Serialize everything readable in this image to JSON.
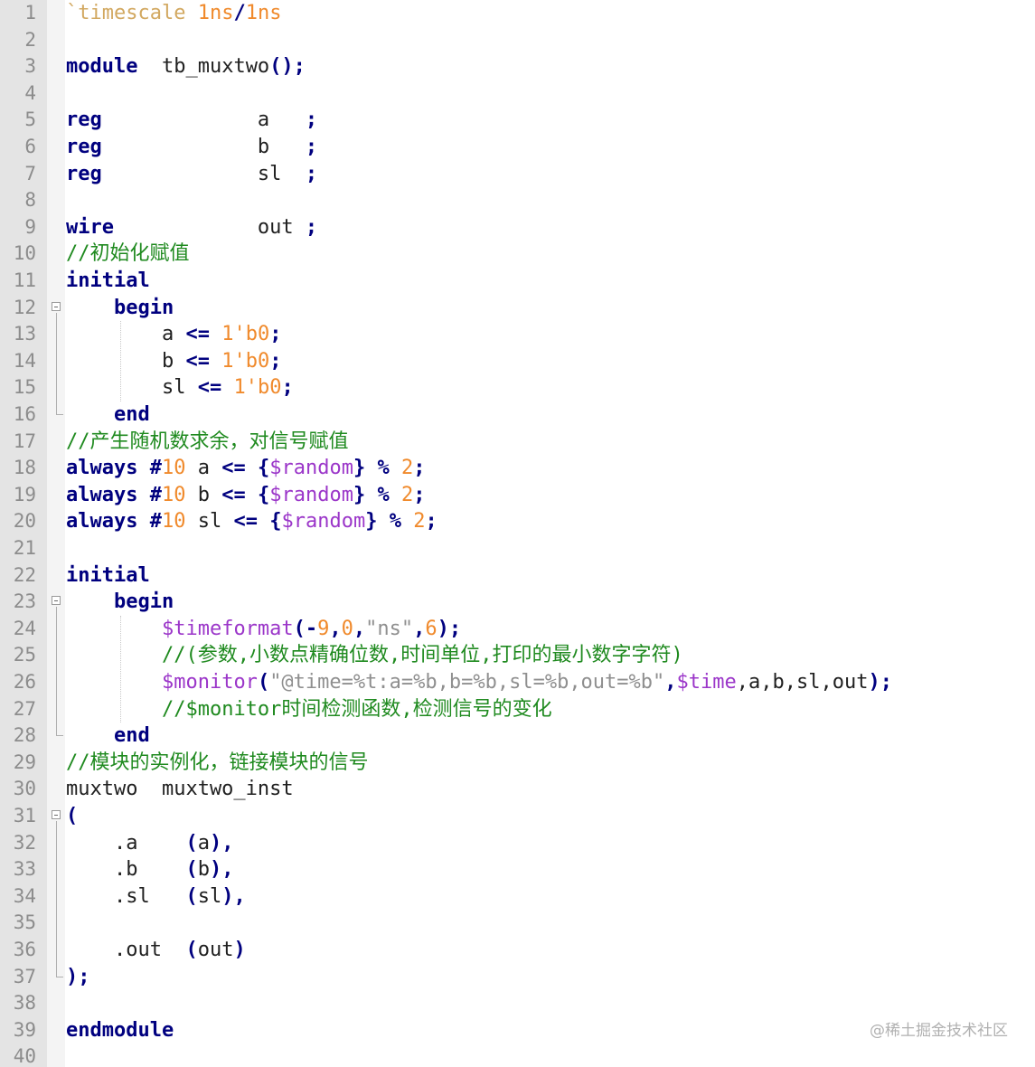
{
  "editor": {
    "lines": [
      {
        "n": "1",
        "tokens": [
          [
            "`timescale",
            "ws"
          ],
          [
            " ",
            "id"
          ],
          [
            "1ns",
            "num"
          ],
          [
            "/",
            "op"
          ],
          [
            "1ns",
            "num"
          ]
        ]
      },
      {
        "n": "2",
        "tokens": []
      },
      {
        "n": "3",
        "tokens": [
          [
            "module",
            "kw"
          ],
          [
            "  tb_muxtwo",
            "id"
          ],
          [
            "();",
            "op"
          ]
        ]
      },
      {
        "n": "4",
        "tokens": []
      },
      {
        "n": "5",
        "tokens": [
          [
            "reg",
            "kw"
          ],
          [
            "             a   ",
            "id"
          ],
          [
            ";",
            "op"
          ]
        ]
      },
      {
        "n": "6",
        "tokens": [
          [
            "reg",
            "kw"
          ],
          [
            "             b   ",
            "id"
          ],
          [
            ";",
            "op"
          ]
        ]
      },
      {
        "n": "7",
        "tokens": [
          [
            "reg",
            "kw"
          ],
          [
            "             sl  ",
            "id"
          ],
          [
            ";",
            "op"
          ]
        ]
      },
      {
        "n": "8",
        "tokens": []
      },
      {
        "n": "9",
        "tokens": [
          [
            "wire",
            "kw"
          ],
          [
            "            out ",
            "id"
          ],
          [
            ";",
            "op"
          ]
        ]
      },
      {
        "n": "10",
        "tokens": [
          [
            "//初始化赋值",
            "cm"
          ]
        ]
      },
      {
        "n": "11",
        "tokens": [
          [
            "initial",
            "kw"
          ]
        ]
      },
      {
        "n": "12",
        "tokens": [
          [
            "    ",
            "id"
          ],
          [
            "begin",
            "kw"
          ]
        ]
      },
      {
        "n": "13",
        "tokens": [
          [
            "        a ",
            "id"
          ],
          [
            "<=",
            "op"
          ],
          [
            " ",
            "id"
          ],
          [
            "1'b0",
            "num"
          ],
          [
            ";",
            "op"
          ]
        ]
      },
      {
        "n": "14",
        "tokens": [
          [
            "        b ",
            "id"
          ],
          [
            "<=",
            "op"
          ],
          [
            " ",
            "id"
          ],
          [
            "1'b0",
            "num"
          ],
          [
            ";",
            "op"
          ]
        ]
      },
      {
        "n": "15",
        "tokens": [
          [
            "        sl ",
            "id"
          ],
          [
            "<=",
            "op"
          ],
          [
            " ",
            "id"
          ],
          [
            "1'b0",
            "num"
          ],
          [
            ";",
            "op"
          ]
        ]
      },
      {
        "n": "16",
        "tokens": [
          [
            "    ",
            "id"
          ],
          [
            "end",
            "kw"
          ]
        ]
      },
      {
        "n": "17",
        "tokens": [
          [
            "//产生随机数求余，对信号赋值",
            "cm"
          ]
        ]
      },
      {
        "n": "18",
        "tokens": [
          [
            "always",
            "kw"
          ],
          [
            " ",
            "id"
          ],
          [
            "#",
            "op"
          ],
          [
            "10",
            "num"
          ],
          [
            " a ",
            "id"
          ],
          [
            "<=",
            "op"
          ],
          [
            " ",
            "id"
          ],
          [
            "{",
            "op"
          ],
          [
            "$random",
            "sys"
          ],
          [
            "}",
            "op"
          ],
          [
            " ",
            "id"
          ],
          [
            "%",
            "op"
          ],
          [
            " ",
            "id"
          ],
          [
            "2",
            "num"
          ],
          [
            ";",
            "op"
          ]
        ]
      },
      {
        "n": "19",
        "tokens": [
          [
            "always",
            "kw"
          ],
          [
            " ",
            "id"
          ],
          [
            "#",
            "op"
          ],
          [
            "10",
            "num"
          ],
          [
            " b ",
            "id"
          ],
          [
            "<=",
            "op"
          ],
          [
            " ",
            "id"
          ],
          [
            "{",
            "op"
          ],
          [
            "$random",
            "sys"
          ],
          [
            "}",
            "op"
          ],
          [
            " ",
            "id"
          ],
          [
            "%",
            "op"
          ],
          [
            " ",
            "id"
          ],
          [
            "2",
            "num"
          ],
          [
            ";",
            "op"
          ]
        ]
      },
      {
        "n": "20",
        "tokens": [
          [
            "always",
            "kw"
          ],
          [
            " ",
            "id"
          ],
          [
            "#",
            "op"
          ],
          [
            "10",
            "num"
          ],
          [
            " sl ",
            "id"
          ],
          [
            "<=",
            "op"
          ],
          [
            " ",
            "id"
          ],
          [
            "{",
            "op"
          ],
          [
            "$random",
            "sys"
          ],
          [
            "}",
            "op"
          ],
          [
            " ",
            "id"
          ],
          [
            "%",
            "op"
          ],
          [
            " ",
            "id"
          ],
          [
            "2",
            "num"
          ],
          [
            ";",
            "op"
          ]
        ]
      },
      {
        "n": "21",
        "tokens": []
      },
      {
        "n": "22",
        "tokens": [
          [
            "initial",
            "kw"
          ]
        ]
      },
      {
        "n": "23",
        "tokens": [
          [
            "    ",
            "id"
          ],
          [
            "begin",
            "kw"
          ]
        ]
      },
      {
        "n": "24",
        "tokens": [
          [
            "        ",
            "id"
          ],
          [
            "$timeformat",
            "sys"
          ],
          [
            "(",
            "op"
          ],
          [
            "-",
            "op"
          ],
          [
            "9",
            "num"
          ],
          [
            ",",
            "op"
          ],
          [
            "0",
            "num"
          ],
          [
            ",",
            "op"
          ],
          [
            "\"ns\"",
            "str"
          ],
          [
            ",",
            "op"
          ],
          [
            "6",
            "num"
          ],
          [
            ");",
            "op"
          ]
        ]
      },
      {
        "n": "25",
        "tokens": [
          [
            "        ",
            "id"
          ],
          [
            "//(参数,小数点精确位数,时间单位,打印的最小数字字符)",
            "cm"
          ]
        ]
      },
      {
        "n": "26",
        "tokens": [
          [
            "        ",
            "id"
          ],
          [
            "$monitor",
            "sys"
          ],
          [
            "(",
            "op"
          ],
          [
            "\"@time=%t:a=%b,b=%b,sl=%b,out=%b\"",
            "str"
          ],
          [
            ",",
            "op"
          ],
          [
            "$time",
            "sys"
          ],
          [
            ",a,b,sl,out",
            "id"
          ],
          [
            ");",
            "op"
          ]
        ]
      },
      {
        "n": "27",
        "tokens": [
          [
            "        ",
            "id"
          ],
          [
            "//$monitor时间检测函数,检测信号的变化",
            "cm"
          ]
        ]
      },
      {
        "n": "28",
        "tokens": [
          [
            "    ",
            "id"
          ],
          [
            "end",
            "kw"
          ]
        ]
      },
      {
        "n": "29",
        "tokens": [
          [
            "//模块的实例化，链接模块的信号",
            "cm"
          ]
        ]
      },
      {
        "n": "30",
        "tokens": [
          [
            "muxtwo  muxtwo_inst",
            "id"
          ]
        ]
      },
      {
        "n": "31",
        "tokens": [
          [
            "(",
            "op"
          ]
        ]
      },
      {
        "n": "32",
        "tokens": [
          [
            "    .a    ",
            "id"
          ],
          [
            "(",
            "op"
          ],
          [
            "a",
            "id"
          ],
          [
            "),",
            "op"
          ]
        ]
      },
      {
        "n": "33",
        "tokens": [
          [
            "    .b    ",
            "id"
          ],
          [
            "(",
            "op"
          ],
          [
            "b",
            "id"
          ],
          [
            "),",
            "op"
          ]
        ]
      },
      {
        "n": "34",
        "tokens": [
          [
            "    .sl   ",
            "id"
          ],
          [
            "(",
            "op"
          ],
          [
            "sl",
            "id"
          ],
          [
            "),",
            "op"
          ]
        ]
      },
      {
        "n": "35",
        "tokens": []
      },
      {
        "n": "36",
        "tokens": [
          [
            "    .out  ",
            "id"
          ],
          [
            "(",
            "op"
          ],
          [
            "out",
            "id"
          ],
          [
            ")",
            "op"
          ]
        ]
      },
      {
        "n": "37",
        "tokens": [
          [
            ");",
            "op"
          ]
        ]
      },
      {
        "n": "38",
        "tokens": []
      },
      {
        "n": "39",
        "tokens": [
          [
            "endmodule",
            "kw"
          ]
        ]
      },
      {
        "n": "40",
        "tokens": []
      }
    ],
    "fold_starts": [
      "12",
      "23",
      "31"
    ]
  },
  "watermark": "@稀土掘金技术社区"
}
